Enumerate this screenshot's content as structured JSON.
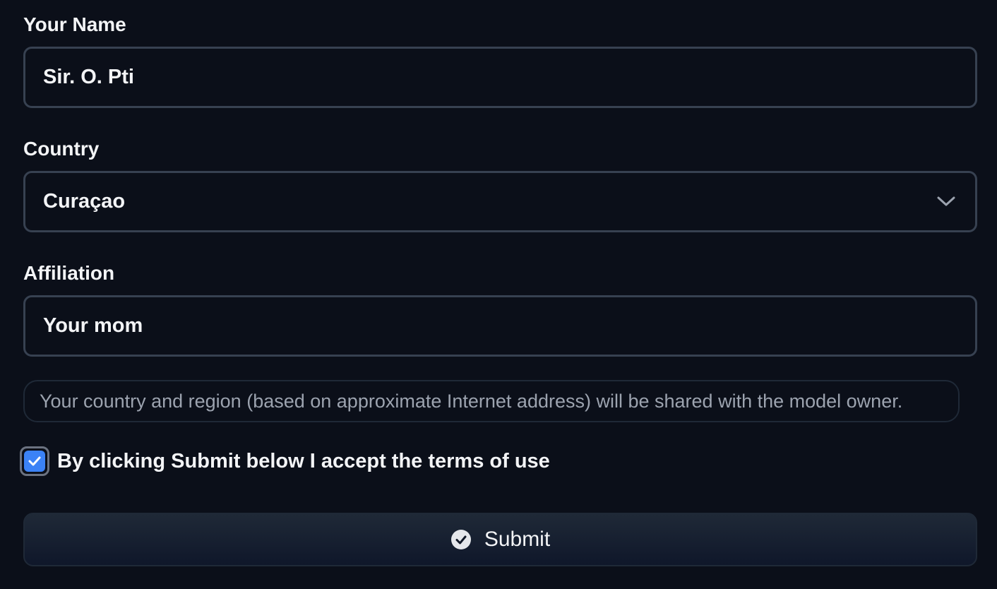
{
  "form": {
    "name": {
      "label": "Your Name",
      "value": "Sir. O. Pti"
    },
    "country": {
      "label": "Country",
      "selected": "Curaçao",
      "icon": "chevron-down-icon"
    },
    "affiliation": {
      "label": "Affiliation",
      "value": "Your mom"
    },
    "notice": "Your country and region (based on approximate Internet address) will be shared with the model owner.",
    "terms": {
      "label": "By clicking Submit below I accept the terms of use",
      "checked": true,
      "icon": "checkmark-icon"
    },
    "submit": {
      "label": "Submit",
      "icon": "check-circle-icon"
    }
  },
  "colors": {
    "background": "#0b0f19",
    "input_border": "#374151",
    "checkbox_accent": "#3b82f6",
    "text_primary": "#f3f4f6",
    "text_muted": "#9ca3af"
  }
}
